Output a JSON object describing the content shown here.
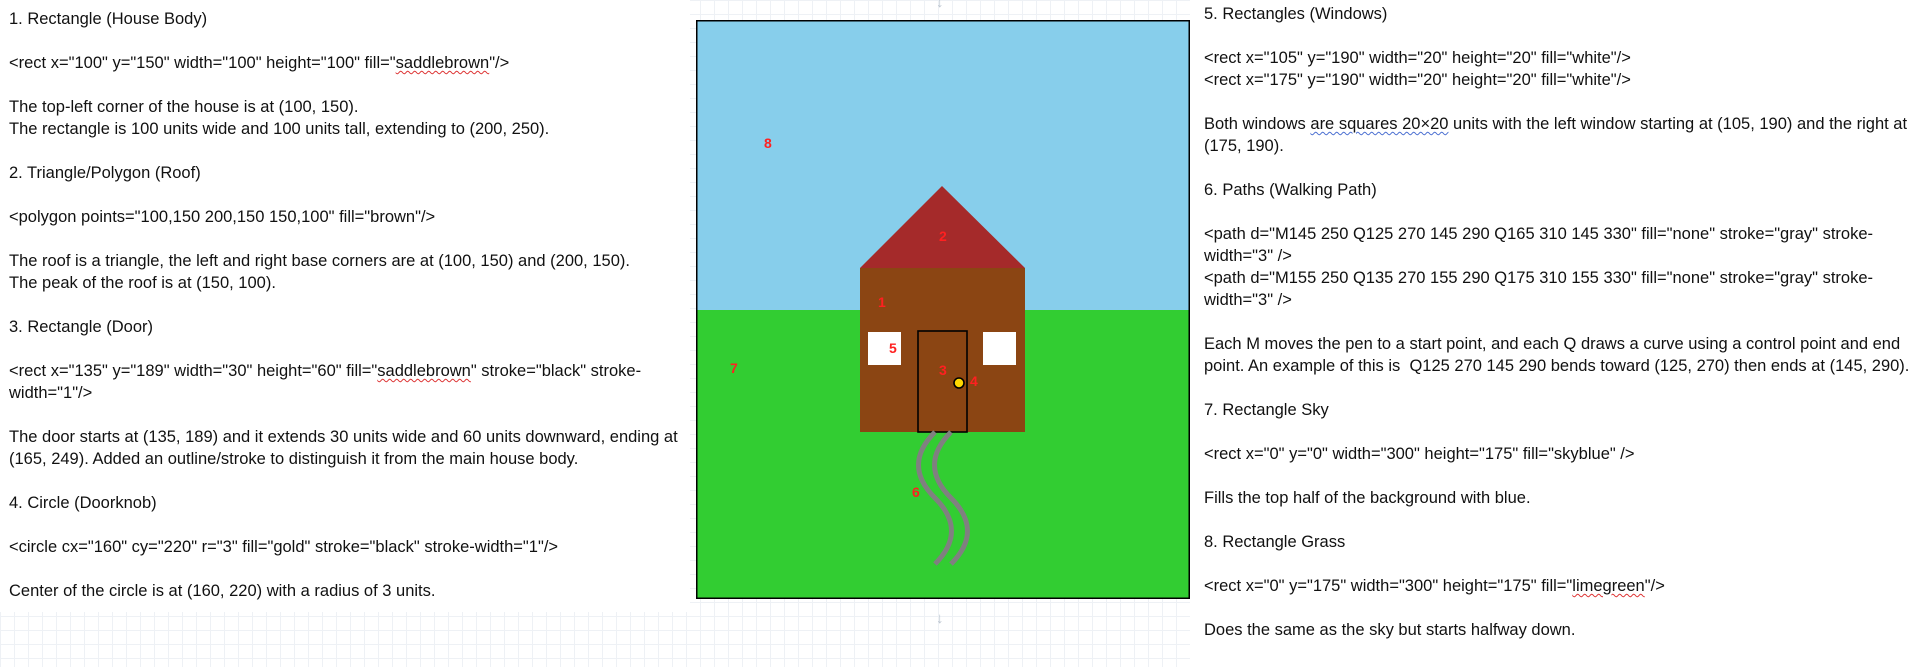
{
  "left_notes": {
    "s1_title": "1. Rectangle (House Body)",
    "s1_code_pre": "<rect x=\"100\" y=\"150\" width=\"100\" height=\"100\" fill=\"",
    "s1_code_word": "saddlebrown",
    "s1_code_post": "\"/>",
    "s1_desc1": "The top-left corner of the house is at (100, 150).",
    "s1_desc2": "The rectangle is 100 units wide and 100 units tall, extending to (200, 250).",
    "s2_title": "2. Triangle/Polygon (Roof)",
    "s2_code": "<polygon points=\"100,150 200,150 150,100\" fill=\"brown\"/>",
    "s2_desc1": "The roof is a triangle, the left and right base corners are at (100, 150) and (200, 150).",
    "s2_desc2": "The peak of the roof is at (150, 100).",
    "s3_title": "3. Rectangle (Door)",
    "s3_code_pre": "<rect x=\"135\" y=\"189\" width=\"30\" height=\"60\" fill=\"",
    "s3_code_word": "saddlebrown",
    "s3_code_post": "\" stroke=\"black\" stroke-width=\"1\"/>",
    "s3_desc": "The door starts at (135, 189) and it extends 30 units wide and 60 units downward, ending at (165, 249). Added an outline/stroke to distinguish it from the main house body.",
    "s4_title": "4. Circle (Doorknob)",
    "s4_code": "<circle cx=\"160\" cy=\"220\" r=\"3\" fill=\"gold\" stroke=\"black\" stroke-width=\"1\"/>",
    "s4_desc": "Center of the circle is at (160, 220) with a radius of 3 units."
  },
  "right_notes": {
    "s5_title": "5. Rectangles (Windows)",
    "s5_code1": "<rect x=\"105\" y=\"190\" width=\"20\" height=\"20\" fill=\"white\"/>",
    "s5_code2": "<rect x=\"175\" y=\"190\" width=\"20\" height=\"20\" fill=\"white\"/>",
    "s5_desc_a": "Both windows ",
    "s5_desc_word": "are squares 20×20",
    "s5_desc_b": " units with the left window starting at (105, 190) and the right at (175, 190).",
    "s6_title": "6. Paths (Walking Path)",
    "s6_code1": "<path d=\"M145 250 Q125 270 145 290 Q165 310 145 330\" fill=\"none\" stroke=\"gray\" stroke-width=\"3\" />",
    "s6_code2": "<path d=\"M155 250 Q135 270 155 290 Q175 310 155 330\" fill=\"none\" stroke=\"gray\" stroke-width=\"3\" />",
    "s6_desc": "Each M moves the pen to a start point, and each Q draws a curve using a control point and end point. An example of this is  Q125 270 145 290 bends toward (125, 270) then ends at (145, 290).",
    "s7_title": "7. Rectangle Sky",
    "s7_code": "<rect x=\"0\" y=\"0\" width=\"300\" height=\"175\" fill=\"skyblue\" />",
    "s7_desc": "Fills the top half of the background with blue.",
    "s8_title": "8. Rectangle Grass",
    "s8_code_pre": "<rect x=\"0\" y=\"175\" width=\"300\" height=\"175\" fill=\"",
    "s8_code_word": "limegreen",
    "s8_code_post": "\"/>",
    "s8_desc": "Does the same as the sky but starts halfway down."
  },
  "drawing": {
    "colors": {
      "sky": "#87CEEB",
      "grass": "#32CD32",
      "house": "#8B4513",
      "roof": "#A52A2A",
      "door": "#8B4513",
      "window": "#ffffff",
      "knob": "#FFD700",
      "path": "#808080",
      "label": "#ff2020"
    },
    "labels": [
      "1",
      "2",
      "3",
      "4",
      "5",
      "6",
      "7",
      "8"
    ]
  },
  "page_icons": {
    "top_marker": "arrow-down-icon",
    "bottom_marker": "arrow-down-icon"
  }
}
